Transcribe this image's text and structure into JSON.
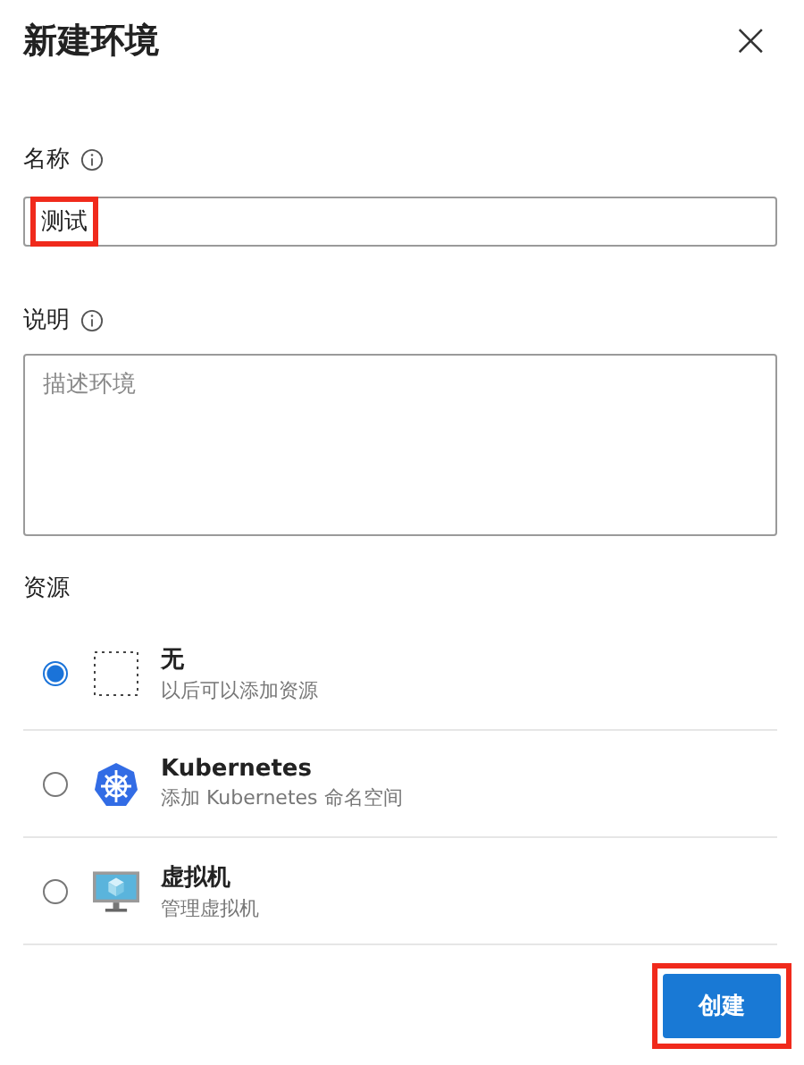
{
  "dialog": {
    "title": "新建环境",
    "close": "×"
  },
  "name_field": {
    "label": "名称",
    "value": "测试",
    "highlighted": true
  },
  "description_field": {
    "label": "说明",
    "placeholder": "描述环境"
  },
  "resources": {
    "label": "资源",
    "options": [
      {
        "kind": "none",
        "title": "无",
        "subtitle": "以后可以添加资源",
        "selected": true
      },
      {
        "kind": "kubernetes",
        "title": "Kubernetes",
        "subtitle": "添加 Kubernetes 命名空间",
        "selected": false
      },
      {
        "kind": "vm",
        "title": "虚拟机",
        "subtitle": "管理虚拟机",
        "selected": false
      }
    ]
  },
  "create_button": {
    "label": "创建",
    "highlighted": true
  }
}
